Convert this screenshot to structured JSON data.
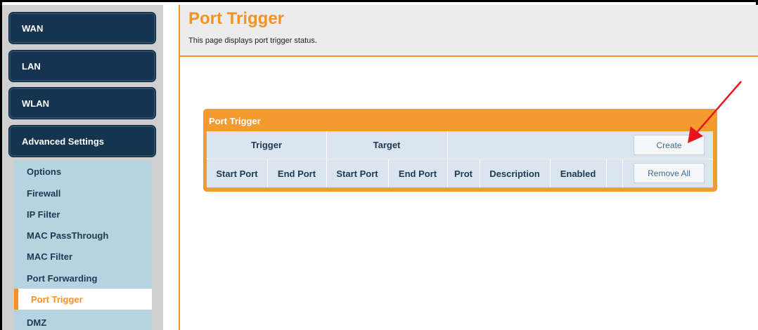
{
  "sidebar": {
    "sections": [
      {
        "label": "WAN"
      },
      {
        "label": "LAN"
      },
      {
        "label": "WLAN"
      },
      {
        "label": "Advanced Settings"
      }
    ],
    "items": [
      {
        "label": "Options"
      },
      {
        "label": "Firewall"
      },
      {
        "label": "IP Filter"
      },
      {
        "label": "MAC PassThrough"
      },
      {
        "label": "MAC Filter"
      },
      {
        "label": "Port Forwarding"
      },
      {
        "label": "Port Trigger",
        "active": true
      },
      {
        "label": "DMZ"
      }
    ]
  },
  "main": {
    "title": "Port Trigger",
    "description": "This page displays port trigger status.",
    "panel": {
      "title": "Port Trigger",
      "group_headers": {
        "trigger": "Trigger",
        "target": "Target"
      },
      "columns": [
        "Start Port",
        "End Port",
        "Start Port",
        "End Port",
        "Prot",
        "Description",
        "Enabled"
      ],
      "create_label": "Create",
      "remove_all_label": "Remove All"
    }
  },
  "colors": {
    "accent": "#f39325",
    "nav_dark": "#14344f",
    "submenu_bg": "#b5d3e0",
    "table_bg": "#dbe5ef",
    "annotation_arrow": "#e8141c"
  }
}
